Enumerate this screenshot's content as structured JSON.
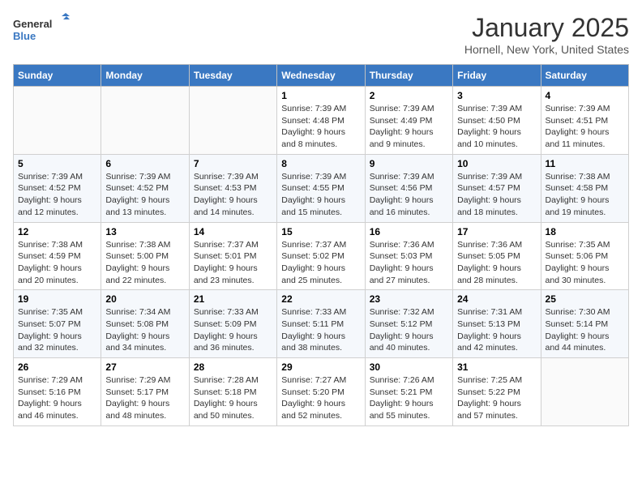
{
  "header": {
    "logo_line1": "General",
    "logo_line2": "Blue",
    "month": "January 2025",
    "location": "Hornell, New York, United States"
  },
  "days_of_week": [
    "Sunday",
    "Monday",
    "Tuesday",
    "Wednesday",
    "Thursday",
    "Friday",
    "Saturday"
  ],
  "weeks": [
    [
      {
        "day": "",
        "sunrise": "",
        "sunset": "",
        "daylight": ""
      },
      {
        "day": "",
        "sunrise": "",
        "sunset": "",
        "daylight": ""
      },
      {
        "day": "",
        "sunrise": "",
        "sunset": "",
        "daylight": ""
      },
      {
        "day": "1",
        "sunrise": "Sunrise: 7:39 AM",
        "sunset": "Sunset: 4:48 PM",
        "daylight": "Daylight: 9 hours and 8 minutes."
      },
      {
        "day": "2",
        "sunrise": "Sunrise: 7:39 AM",
        "sunset": "Sunset: 4:49 PM",
        "daylight": "Daylight: 9 hours and 9 minutes."
      },
      {
        "day": "3",
        "sunrise": "Sunrise: 7:39 AM",
        "sunset": "Sunset: 4:50 PM",
        "daylight": "Daylight: 9 hours and 10 minutes."
      },
      {
        "day": "4",
        "sunrise": "Sunrise: 7:39 AM",
        "sunset": "Sunset: 4:51 PM",
        "daylight": "Daylight: 9 hours and 11 minutes."
      }
    ],
    [
      {
        "day": "5",
        "sunrise": "Sunrise: 7:39 AM",
        "sunset": "Sunset: 4:52 PM",
        "daylight": "Daylight: 9 hours and 12 minutes."
      },
      {
        "day": "6",
        "sunrise": "Sunrise: 7:39 AM",
        "sunset": "Sunset: 4:52 PM",
        "daylight": "Daylight: 9 hours and 13 minutes."
      },
      {
        "day": "7",
        "sunrise": "Sunrise: 7:39 AM",
        "sunset": "Sunset: 4:53 PM",
        "daylight": "Daylight: 9 hours and 14 minutes."
      },
      {
        "day": "8",
        "sunrise": "Sunrise: 7:39 AM",
        "sunset": "Sunset: 4:55 PM",
        "daylight": "Daylight: 9 hours and 15 minutes."
      },
      {
        "day": "9",
        "sunrise": "Sunrise: 7:39 AM",
        "sunset": "Sunset: 4:56 PM",
        "daylight": "Daylight: 9 hours and 16 minutes."
      },
      {
        "day": "10",
        "sunrise": "Sunrise: 7:39 AM",
        "sunset": "Sunset: 4:57 PM",
        "daylight": "Daylight: 9 hours and 18 minutes."
      },
      {
        "day": "11",
        "sunrise": "Sunrise: 7:38 AM",
        "sunset": "Sunset: 4:58 PM",
        "daylight": "Daylight: 9 hours and 19 minutes."
      }
    ],
    [
      {
        "day": "12",
        "sunrise": "Sunrise: 7:38 AM",
        "sunset": "Sunset: 4:59 PM",
        "daylight": "Daylight: 9 hours and 20 minutes."
      },
      {
        "day": "13",
        "sunrise": "Sunrise: 7:38 AM",
        "sunset": "Sunset: 5:00 PM",
        "daylight": "Daylight: 9 hours and 22 minutes."
      },
      {
        "day": "14",
        "sunrise": "Sunrise: 7:37 AM",
        "sunset": "Sunset: 5:01 PM",
        "daylight": "Daylight: 9 hours and 23 minutes."
      },
      {
        "day": "15",
        "sunrise": "Sunrise: 7:37 AM",
        "sunset": "Sunset: 5:02 PM",
        "daylight": "Daylight: 9 hours and 25 minutes."
      },
      {
        "day": "16",
        "sunrise": "Sunrise: 7:36 AM",
        "sunset": "Sunset: 5:03 PM",
        "daylight": "Daylight: 9 hours and 27 minutes."
      },
      {
        "day": "17",
        "sunrise": "Sunrise: 7:36 AM",
        "sunset": "Sunset: 5:05 PM",
        "daylight": "Daylight: 9 hours and 28 minutes."
      },
      {
        "day": "18",
        "sunrise": "Sunrise: 7:35 AM",
        "sunset": "Sunset: 5:06 PM",
        "daylight": "Daylight: 9 hours and 30 minutes."
      }
    ],
    [
      {
        "day": "19",
        "sunrise": "Sunrise: 7:35 AM",
        "sunset": "Sunset: 5:07 PM",
        "daylight": "Daylight: 9 hours and 32 minutes."
      },
      {
        "day": "20",
        "sunrise": "Sunrise: 7:34 AM",
        "sunset": "Sunset: 5:08 PM",
        "daylight": "Daylight: 9 hours and 34 minutes."
      },
      {
        "day": "21",
        "sunrise": "Sunrise: 7:33 AM",
        "sunset": "Sunset: 5:09 PM",
        "daylight": "Daylight: 9 hours and 36 minutes."
      },
      {
        "day": "22",
        "sunrise": "Sunrise: 7:33 AM",
        "sunset": "Sunset: 5:11 PM",
        "daylight": "Daylight: 9 hours and 38 minutes."
      },
      {
        "day": "23",
        "sunrise": "Sunrise: 7:32 AM",
        "sunset": "Sunset: 5:12 PM",
        "daylight": "Daylight: 9 hours and 40 minutes."
      },
      {
        "day": "24",
        "sunrise": "Sunrise: 7:31 AM",
        "sunset": "Sunset: 5:13 PM",
        "daylight": "Daylight: 9 hours and 42 minutes."
      },
      {
        "day": "25",
        "sunrise": "Sunrise: 7:30 AM",
        "sunset": "Sunset: 5:14 PM",
        "daylight": "Daylight: 9 hours and 44 minutes."
      }
    ],
    [
      {
        "day": "26",
        "sunrise": "Sunrise: 7:29 AM",
        "sunset": "Sunset: 5:16 PM",
        "daylight": "Daylight: 9 hours and 46 minutes."
      },
      {
        "day": "27",
        "sunrise": "Sunrise: 7:29 AM",
        "sunset": "Sunset: 5:17 PM",
        "daylight": "Daylight: 9 hours and 48 minutes."
      },
      {
        "day": "28",
        "sunrise": "Sunrise: 7:28 AM",
        "sunset": "Sunset: 5:18 PM",
        "daylight": "Daylight: 9 hours and 50 minutes."
      },
      {
        "day": "29",
        "sunrise": "Sunrise: 7:27 AM",
        "sunset": "Sunset: 5:20 PM",
        "daylight": "Daylight: 9 hours and 52 minutes."
      },
      {
        "day": "30",
        "sunrise": "Sunrise: 7:26 AM",
        "sunset": "Sunset: 5:21 PM",
        "daylight": "Daylight: 9 hours and 55 minutes."
      },
      {
        "day": "31",
        "sunrise": "Sunrise: 7:25 AM",
        "sunset": "Sunset: 5:22 PM",
        "daylight": "Daylight: 9 hours and 57 minutes."
      },
      {
        "day": "",
        "sunrise": "",
        "sunset": "",
        "daylight": ""
      }
    ]
  ]
}
